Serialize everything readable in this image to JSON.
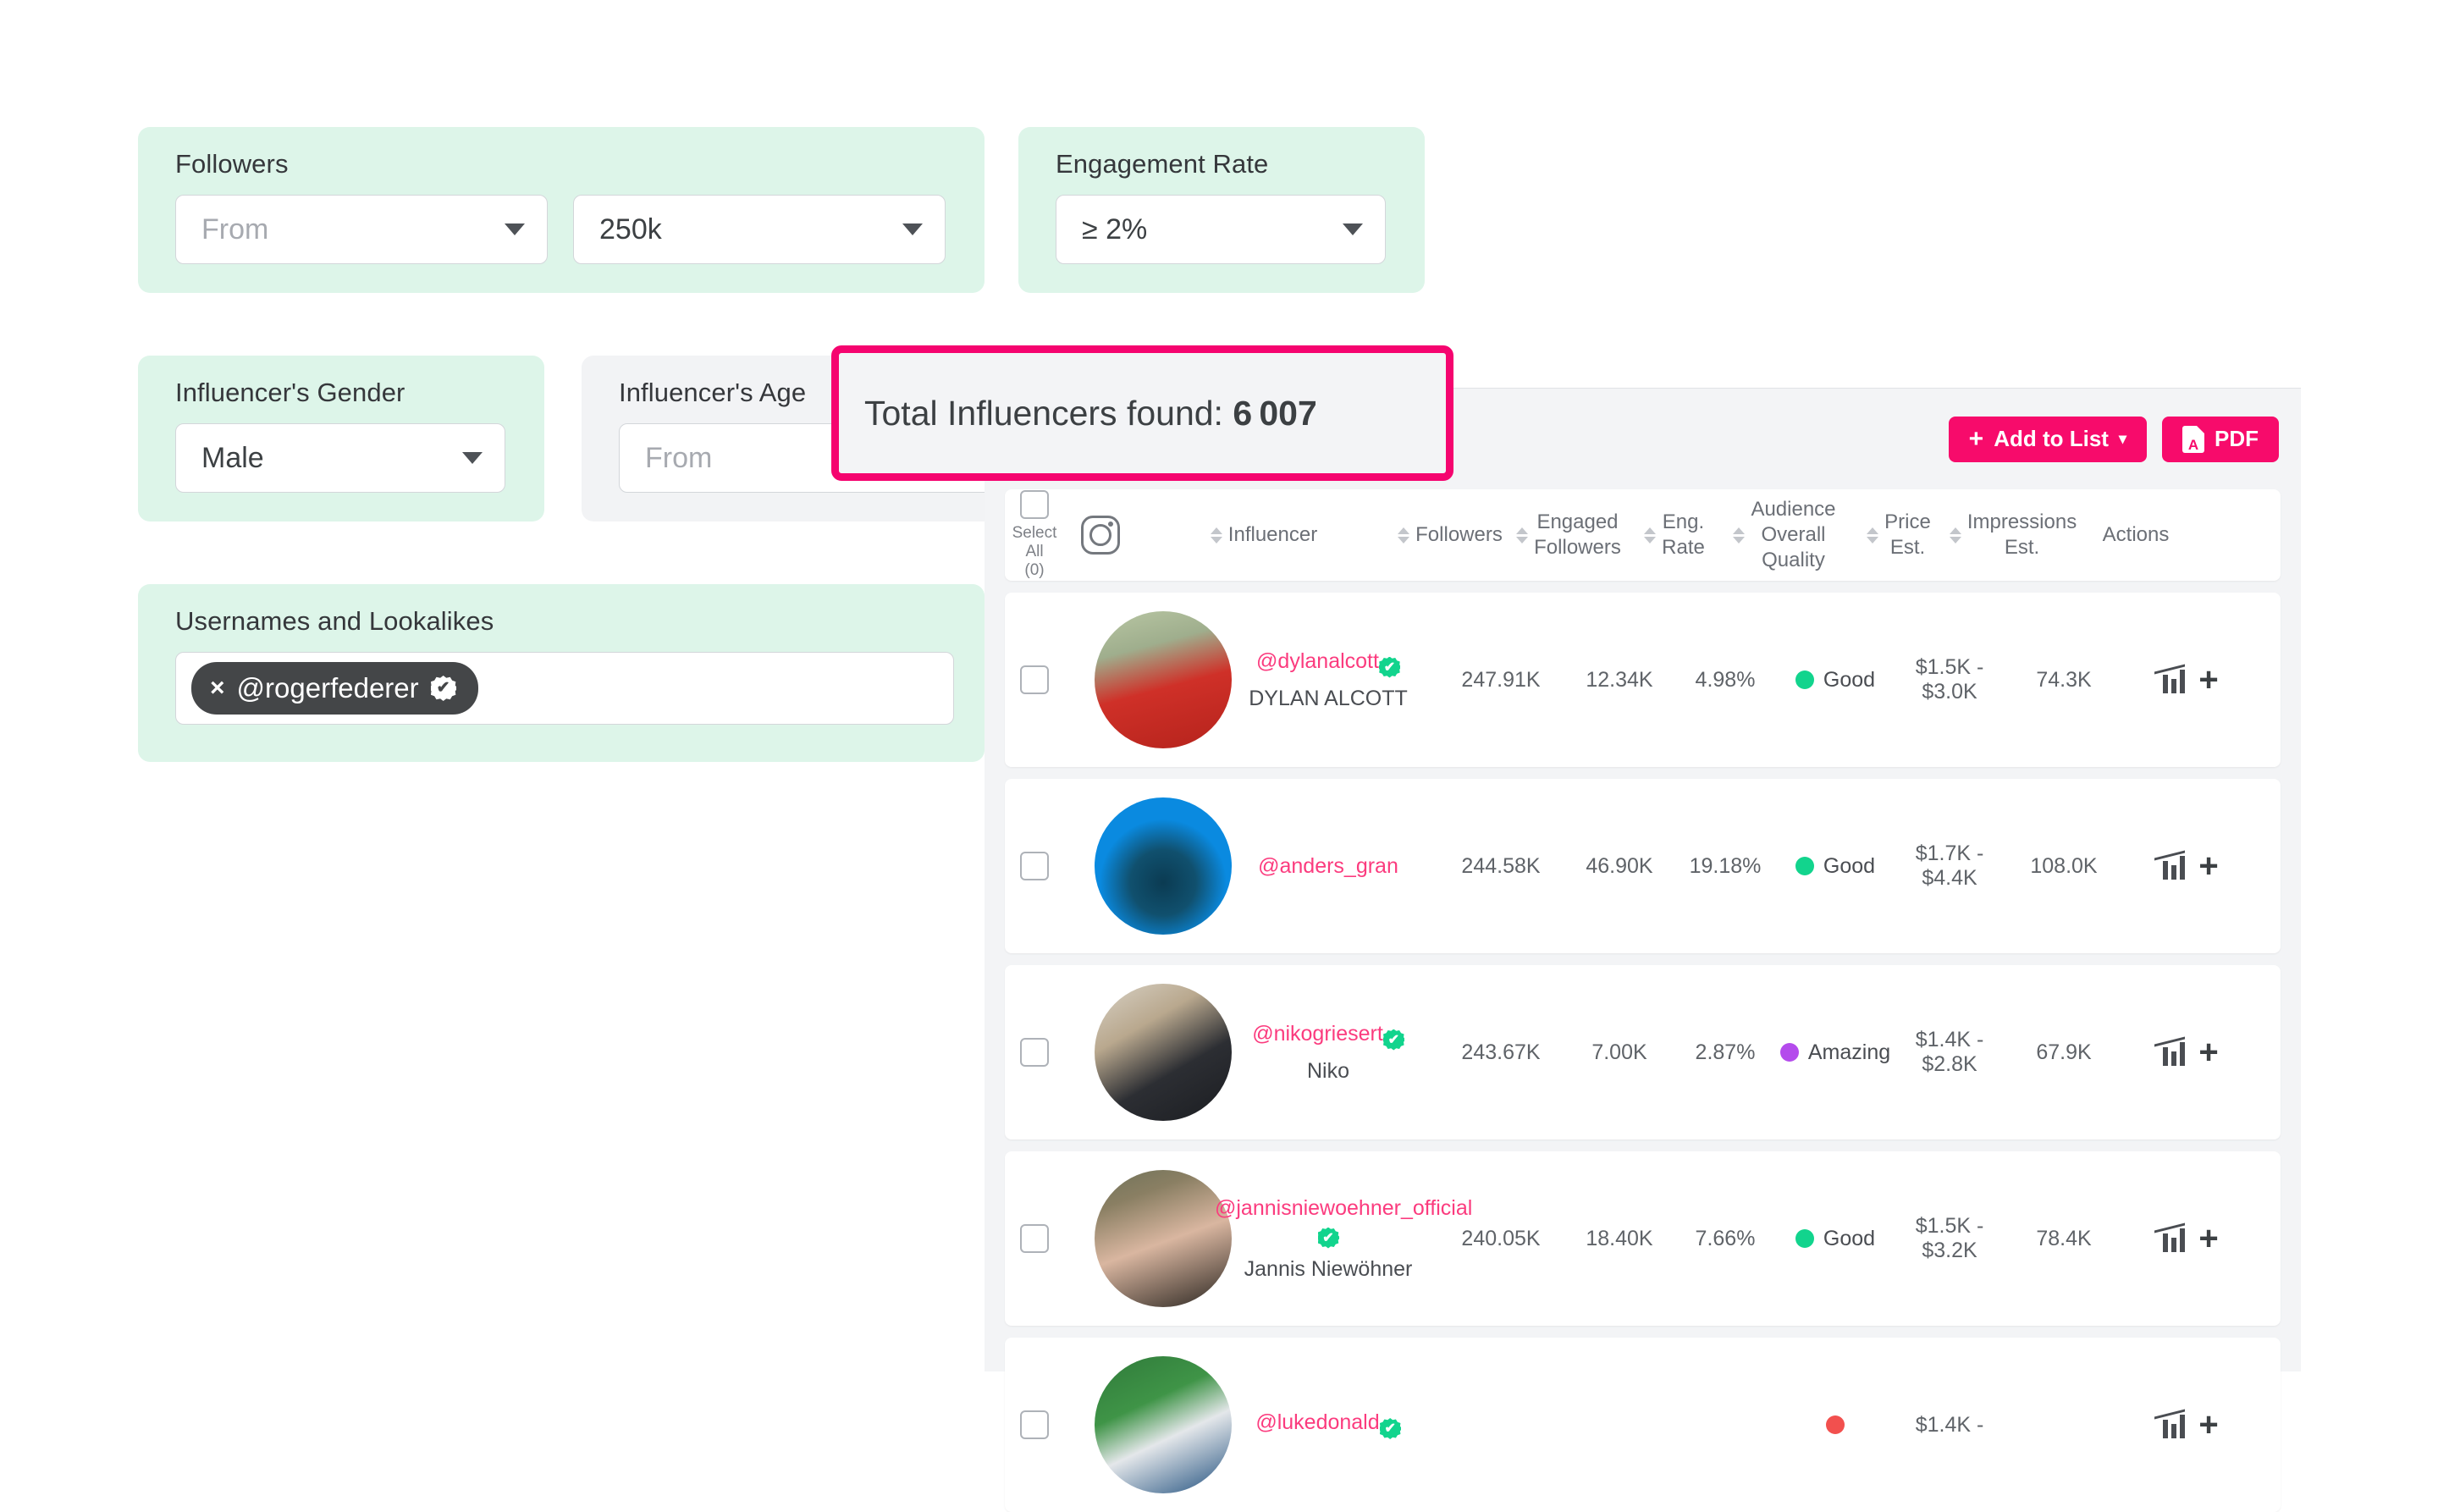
{
  "filters": {
    "followers": {
      "label": "Followers",
      "from_placeholder": "From",
      "to_value": "250k"
    },
    "engagement_rate": {
      "label": "Engagement Rate",
      "value": "≥ 2%"
    },
    "gender": {
      "label": "Influencer's Gender",
      "value": "Male"
    },
    "age": {
      "label": "Influencer's Age",
      "from_placeholder": "From"
    },
    "usernames": {
      "label": "Usernames and Lookalikes",
      "chip_remove": "×",
      "chip_value": "@rogerfederer",
      "chip_verified": "✔"
    }
  },
  "callout": {
    "prefix": "Total Influencers found: ",
    "count": "6 007"
  },
  "toolbar": {
    "add_to_list_label": "Add to List",
    "add_to_list_plus": "+",
    "add_to_list_caret": "▾",
    "pdf_label": "PDF"
  },
  "table": {
    "select_all_label": "Select All",
    "select_all_count": "(0)",
    "platform_icon": "instagram-icon",
    "headers": {
      "influencer": "Influencer",
      "followers": "Followers",
      "engaged_followers_l1": "Engaged",
      "engaged_followers_l2": "Followers",
      "eng_rate_l1": "Eng.",
      "eng_rate_l2": "Rate",
      "audience_l1": "Audience",
      "audience_l2": "Overall",
      "audience_l3": "Quality",
      "price_l1": "Price",
      "price_l2": "Est.",
      "impressions_l1": "Impressions",
      "impressions_l2": "Est.",
      "actions": "Actions"
    },
    "rows": [
      {
        "username": "@dylanalcott",
        "verified": true,
        "verified_below": false,
        "realname": "DYLAN ALCOTT",
        "followers": "247.91K",
        "engaged_followers": "12.34K",
        "eng_rate": "4.98%",
        "quality": "Good",
        "quality_color": "#12d48d",
        "price_l1": "$1.5K -",
        "price_l2": "$3.0K",
        "impressions": "74.3K"
      },
      {
        "username": "@anders_gran",
        "verified": false,
        "verified_below": false,
        "realname": "",
        "followers": "244.58K",
        "engaged_followers": "46.90K",
        "eng_rate": "19.18%",
        "quality": "Good",
        "quality_color": "#12d48d",
        "price_l1": "$1.7K -",
        "price_l2": "$4.4K",
        "impressions": "108.0K"
      },
      {
        "username": "@nikogriesert",
        "verified": true,
        "verified_below": false,
        "realname": "Niko",
        "followers": "243.67K",
        "engaged_followers": "7.00K",
        "eng_rate": "2.87%",
        "quality": "Amazing",
        "quality_color": "#b44bec",
        "price_l1": "$1.4K -",
        "price_l2": "$2.8K",
        "impressions": "67.9K"
      },
      {
        "username": "@jannisniewoehner_official",
        "verified": true,
        "verified_below": true,
        "realname": "Jannis Niewöhner",
        "followers": "240.05K",
        "engaged_followers": "18.40K",
        "eng_rate": "7.66%",
        "quality": "Good",
        "quality_color": "#12d48d",
        "price_l1": "$1.5K -",
        "price_l2": "$3.2K",
        "impressions": "78.4K"
      },
      {
        "username": "@lukedonald",
        "verified": true,
        "verified_below": false,
        "realname": "",
        "followers": "",
        "engaged_followers": "",
        "eng_rate": "",
        "quality": "",
        "quality_color": "#f2504e",
        "price_l1": "$1.4K -",
        "price_l2": "",
        "impressions": ""
      }
    ]
  },
  "colors": {
    "accent_pink": "#f70b6b",
    "callout_border": "#f5046f",
    "panel_green": "#ddf5e9",
    "panel_grey": "#f2f3f5",
    "username_pink": "#fb3b7e"
  }
}
